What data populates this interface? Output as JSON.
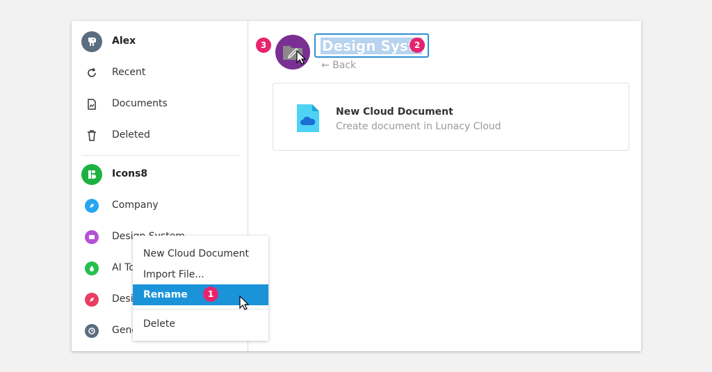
{
  "sidebar": {
    "user": {
      "name": "Alex"
    },
    "nav": [
      {
        "label": "Recent",
        "icon": "refresh-icon"
      },
      {
        "label": "Documents",
        "icon": "document-icon"
      },
      {
        "label": "Deleted",
        "icon": "trash-icon"
      }
    ],
    "team": {
      "name": "Icons8",
      "color": "#1eb141"
    },
    "projects": [
      {
        "label": "Company",
        "icon": "rocket-icon",
        "color": "#26a7ef"
      },
      {
        "label": "Design System",
        "icon": "folder-icon",
        "color": "#b353d6"
      },
      {
        "label": "AI To",
        "icon": "drop-icon",
        "color": "#27bf4e"
      },
      {
        "label": "Desi",
        "icon": "rocket-icon",
        "color": "#ea3d63"
      },
      {
        "label": "Gene",
        "icon": "clock-icon",
        "color": "#5b6d80"
      }
    ]
  },
  "main": {
    "title": "Design Syste",
    "back_label": "← Back",
    "card": {
      "title": "New Cloud Document",
      "subtitle": "Create document in Lunacy Cloud"
    }
  },
  "context_menu": {
    "items": [
      {
        "label": "New Cloud Document"
      },
      {
        "label": "Import File..."
      },
      {
        "label": "Rename",
        "active": true
      },
      {
        "label": "Delete"
      }
    ]
  },
  "badges": {
    "rename_step": "1",
    "title_step": "2",
    "avatar_step": "3"
  },
  "colors": {
    "accent": "#1a93d9",
    "badge": "#e6246e",
    "folder_avatar": "#7a2f92"
  }
}
